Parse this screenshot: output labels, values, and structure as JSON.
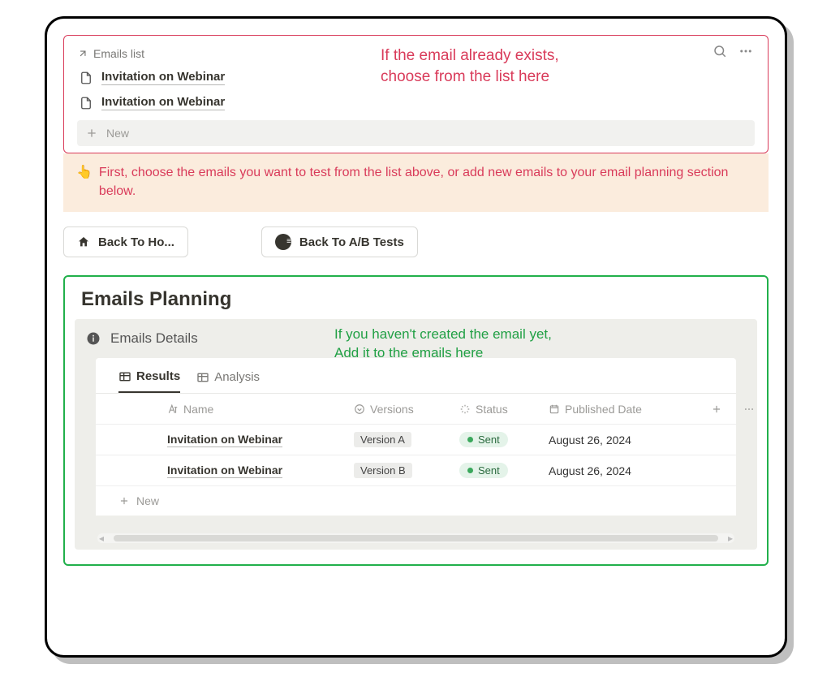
{
  "top_list": {
    "title": "Emails list",
    "items": [
      {
        "label": "Invitation on Webinar"
      },
      {
        "label": "Invitation on Webinar"
      }
    ],
    "new_label": "New"
  },
  "annotation_red_line1": "If the email already exists,",
  "annotation_red_line2": "choose from the list here",
  "callout": {
    "emoji": "👆",
    "text": "First, choose the emails you want to test from the list above, or add new emails to your email planning section below."
  },
  "buttons": {
    "back_home": "Back To Ho...",
    "back_ab": "Back To A/B Tests"
  },
  "planning": {
    "title": "Emails Planning",
    "details_title": "Emails Details",
    "annotation_green_line1": "If you haven't created the email yet,",
    "annotation_green_line2": "Add it to the emails here",
    "tabs": {
      "results": "Results",
      "analysis": "Analysis"
    },
    "columns": {
      "name": "Name",
      "versions": "Versions",
      "status": "Status",
      "published": "Published Date"
    },
    "rows": [
      {
        "name": "Invitation on Webinar",
        "version": "Version A",
        "status": "Sent",
        "date": "August 26, 2024"
      },
      {
        "name": "Invitation on Webinar",
        "version": "Version B",
        "status": "Sent",
        "date": "August 26, 2024"
      }
    ],
    "new_label": "New"
  }
}
